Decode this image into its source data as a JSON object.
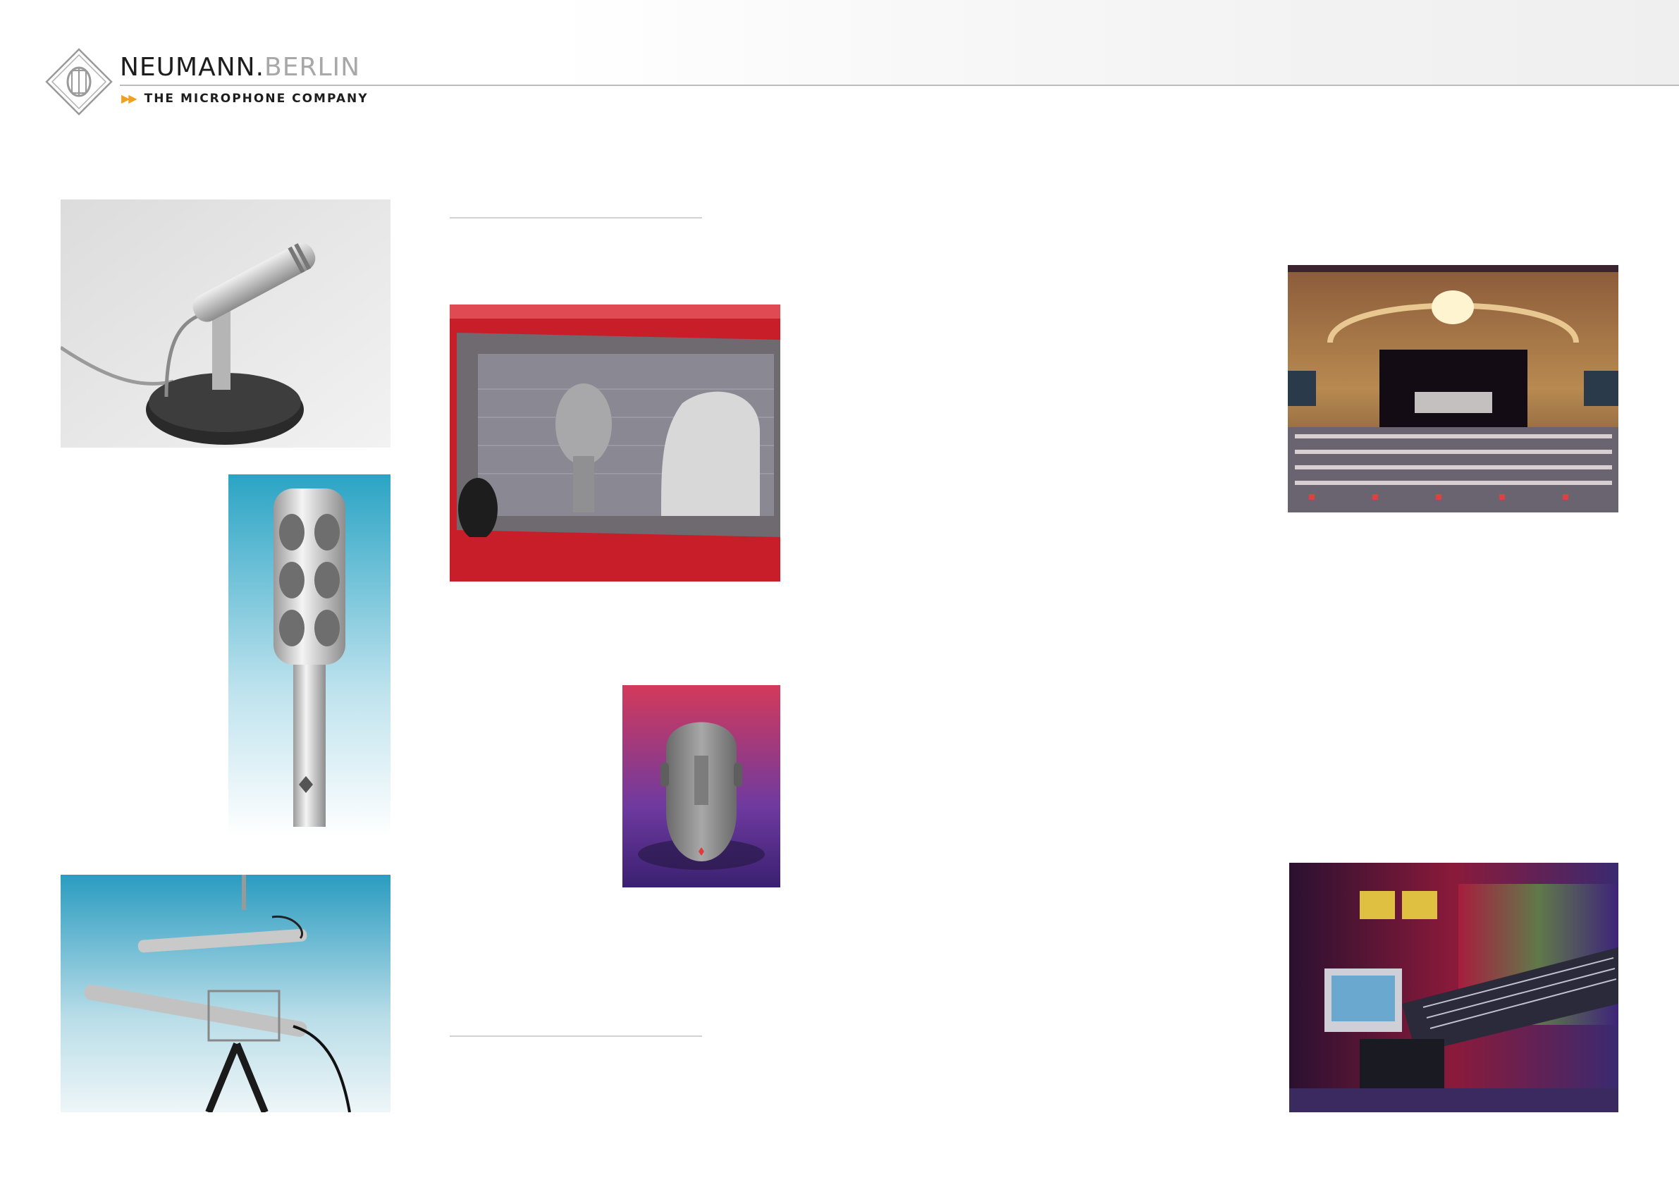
{
  "header": {
    "brand_primary": "NEUMANN.",
    "brand_secondary": "BERLIN",
    "tagline": "THE MICROPHONE COMPANY",
    "tagline_arrows": "▶▶",
    "accent_color": "#f0a020"
  },
  "icons": {
    "logo": "neumann-diamond-logo-icon"
  }
}
